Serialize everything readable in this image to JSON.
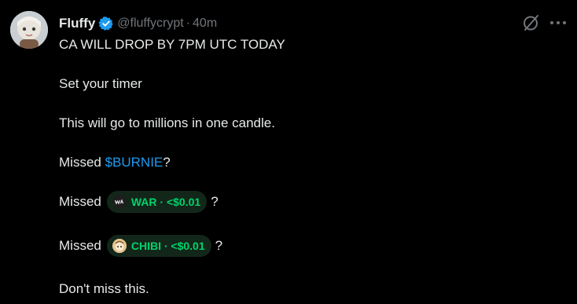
{
  "tweet": {
    "author": {
      "display_name": "Fluffy",
      "handle": "@fluffycrypt",
      "separator": "·",
      "time": "40m",
      "verified": true
    },
    "lines": {
      "l1": "CA WILL DROP BY 7PM UTC TODAY",
      "l2": "Set your timer",
      "l3": "This will go to millions  in one candle.",
      "l4_prefix": "Missed ",
      "l4_cashtag": "$BURNIE",
      "l4_suffix": "?",
      "l5_prefix": "Missed",
      "l5_suffix": "?",
      "l6_prefix": "Missed",
      "l6_suffix": "?",
      "l7": "Don't miss this."
    },
    "tokens": {
      "war": {
        "label": "WAR · <$0.01",
        "icon": "war-token-icon"
      },
      "chibi": {
        "label": "CHIBI · <$0.01",
        "icon": "chibi-token-icon"
      }
    },
    "actions": {
      "grok_icon": "grok-icon",
      "more_icon": "more-icon"
    },
    "colors": {
      "background": "#000000",
      "text": "#e7e9ea",
      "muted": "#71767b",
      "link": "#1d9bf0",
      "token_green": "#00d36b",
      "token_pill_bg": "#13261a",
      "verified_blue": "#1d9bf0"
    }
  }
}
